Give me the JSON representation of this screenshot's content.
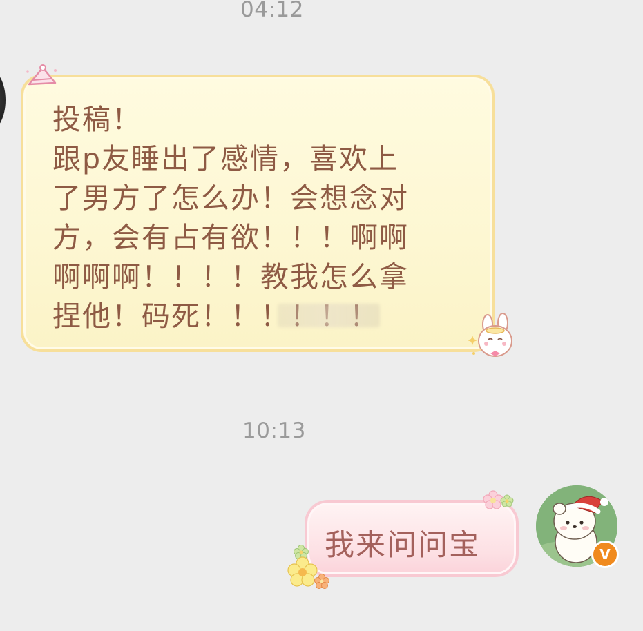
{
  "messages": [
    {
      "timestamp": "04:12",
      "direction": "received",
      "lines": [
        "投稿！",
        "跟p友睡出了感情，喜欢上",
        "了男方了怎么办！会想念对",
        "方，会有占有欲！！！啊啊",
        "啊啊啊！！！！教我怎么拿",
        "捏他！码死！！！！！！"
      ]
    },
    {
      "timestamp": "10:13",
      "direction": "sent",
      "text": "我来问问宝"
    }
  ],
  "avatar_badge": "V",
  "colors": {
    "background": "#ededed",
    "received_bubble": "#fdf7d2",
    "received_border": "#f7df9a",
    "received_text": "#8e5a44",
    "sent_bubble": "#fde0e4",
    "sent_border": "#f8c9d2",
    "sent_text": "#a4615c",
    "timestamp": "#9a9a9a"
  },
  "icons": [
    "party-hat-icon",
    "bunny-sticker-icon",
    "flower-cluster-icon",
    "avatar-bear-santa-hat",
    "verified-v-badge-icon"
  ]
}
